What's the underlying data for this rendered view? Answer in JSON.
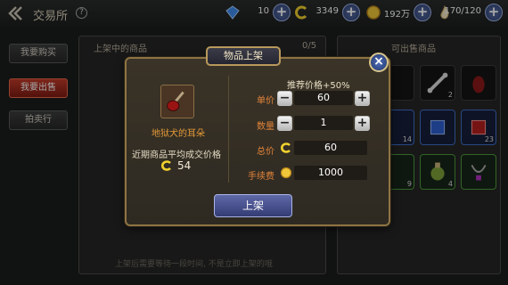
{
  "header": {
    "title": "交易所",
    "help": "?"
  },
  "resources": {
    "diamond": "10",
    "coupon": "3349",
    "gold": "192万",
    "stamina": "170/120"
  },
  "sidebar": {
    "items": [
      {
        "label": "我要购买"
      },
      {
        "label": "我要出售"
      },
      {
        "label": "拍卖行"
      }
    ]
  },
  "left_panel": {
    "header": "上架中的商品",
    "count": "0/5",
    "note": "上架后需要等待一段时间, 不是立即上架的哦"
  },
  "right_panel": {
    "header": "可出售商品",
    "slots": [
      {
        "qty": ""
      },
      {
        "qty": "2"
      },
      {
        "qty": ""
      },
      {
        "qty": "14"
      },
      {
        "qty": ""
      },
      {
        "qty": "23"
      },
      {
        "qty": "9"
      },
      {
        "qty": "4"
      },
      {
        "qty": ""
      }
    ]
  },
  "dialog": {
    "title": "物品上架",
    "close": "×",
    "item_name": "地狱犬的耳朵",
    "avg_label": "近期商品平均成交价格",
    "avg_price": "54",
    "recommend": "推荐价格+50%",
    "unit_price_label": "单价",
    "unit_price": "60",
    "quantity_label": "数量",
    "quantity": "1",
    "total_label": "总价",
    "total": "60",
    "fee_label": "手续费",
    "fee": "1000",
    "minus": "−",
    "plus": "+",
    "list_button": "上架"
  },
  "colors": {
    "accent_orange": "#e2843a",
    "dialog_border": "#8e7444",
    "active_tab": "#c13a2a",
    "button_blue": "#4d5795"
  }
}
